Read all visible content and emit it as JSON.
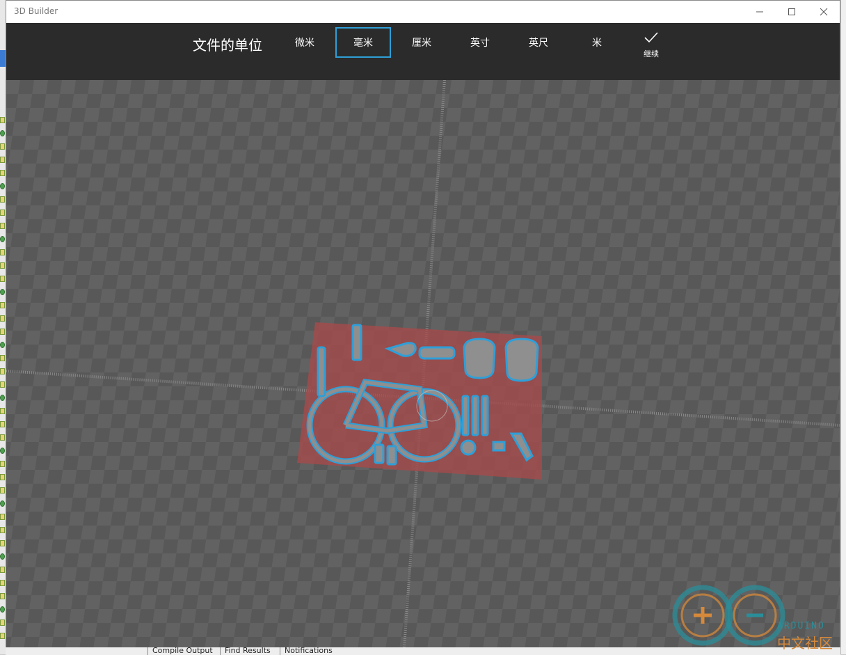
{
  "window": {
    "title": "3D Builder",
    "controls": {
      "minimize": "minimize-icon",
      "maximize": "maximize-icon",
      "close": "close-icon"
    }
  },
  "unit_bar": {
    "label": "文件的单位",
    "units": [
      "微米",
      "毫米",
      "厘米",
      "英寸",
      "英尺",
      "米"
    ],
    "selected_unit": "毫米",
    "continue_label": "继续",
    "accent_color": "#2e9fd8"
  },
  "viewport": {
    "background": "#575757",
    "model_color": "#8f8f8f",
    "model_outline": "#2e9fd8",
    "build_plate_color": "#a84a4a"
  },
  "background_app": {
    "bottom_tabs": [
      "Compile Output",
      "Find Results",
      "Notifications"
    ]
  },
  "watermark": {
    "brand": "ARDUINO",
    "subtitle": "中文社区"
  }
}
